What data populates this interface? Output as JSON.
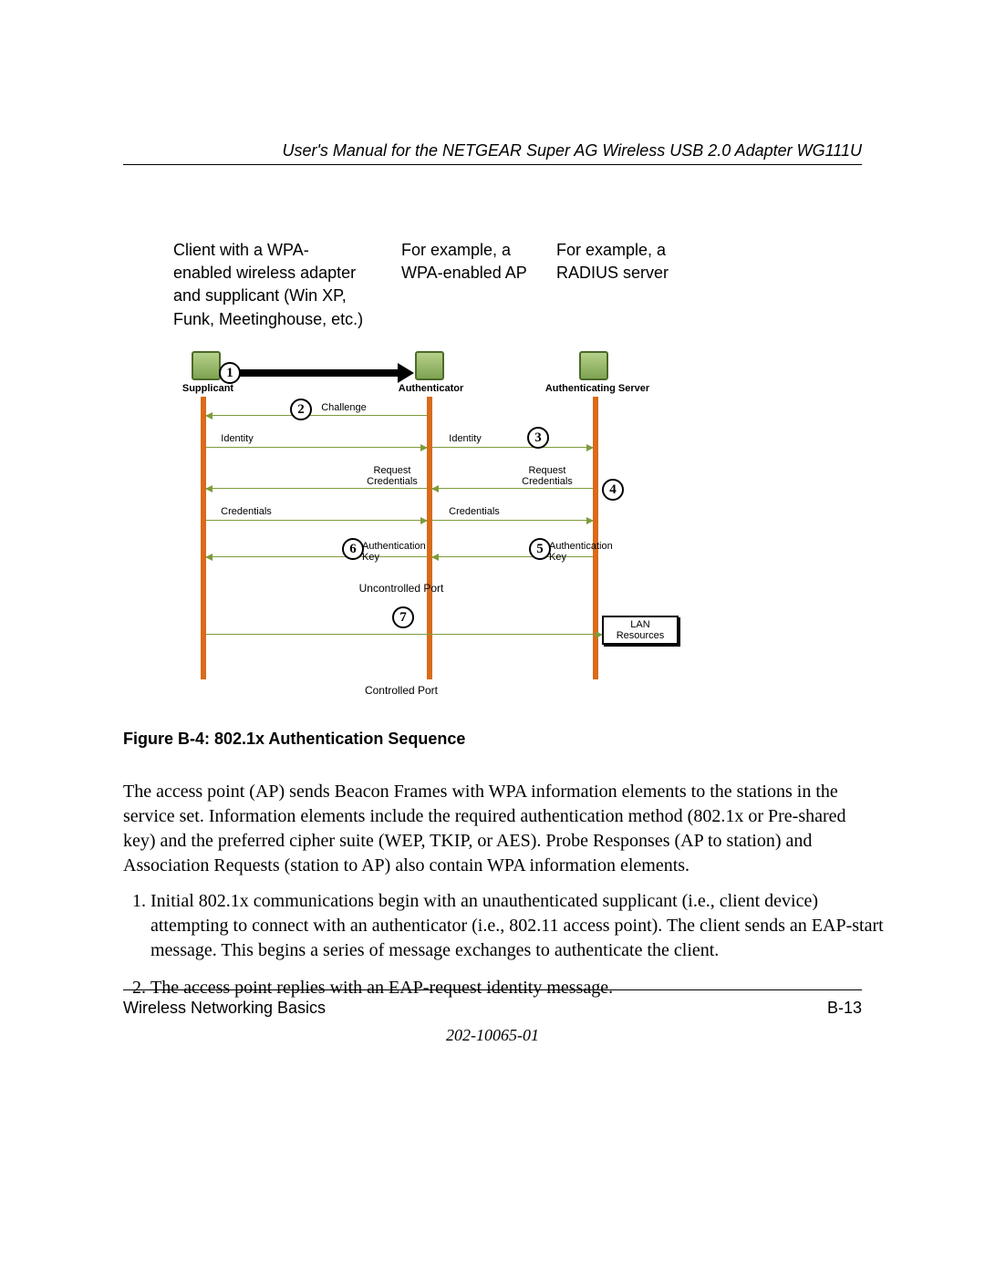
{
  "header": {
    "title": "User's Manual for the NETGEAR Super AG Wireless USB 2.0 Adapter WG111U"
  },
  "figure": {
    "label_supplicant": "Client with a WPA-enabled wireless adapter and supplicant (Win XP, Funk, Meetinghouse, etc.)",
    "label_authenticator": "For example, a WPA-enabled AP",
    "label_server": "For example, a RADIUS server",
    "actor_supplicant": "Supplicant",
    "actor_authenticator": "Authenticator",
    "actor_server": "Authenticating Server",
    "msg_challenge": "Challenge",
    "msg_identity": "Identity",
    "msg_request_credentials": "Request Credentials",
    "msg_credentials": "Credentials",
    "msg_auth_key": "Authentication Key",
    "uncontrolled_port": "Uncontrolled Port",
    "controlled_port": "Controlled Port",
    "lan_resources": "LAN Resources",
    "n1": "1",
    "n2": "2",
    "n3": "3",
    "n4": "4",
    "n5": "5",
    "n6": "6",
    "n7": "7",
    "caption": "Figure B-4:  802.1x Authentication Sequence"
  },
  "body": {
    "para": "The access point (AP) sends Beacon Frames with WPA information elements to the stations in the service set. Information elements include the required authentication method (802.1x or Pre-shared key) and the preferred cipher suite (WEP, TKIP, or AES). Probe Responses (AP to station) and Association Requests (station to AP) also contain WPA information elements.",
    "steps": [
      "Initial 802.1x communications begin with an unauthenticated supplicant (i.e., client device) attempting to connect with an authenticator (i.e., 802.11 access point). The client sends an EAP-start message. This begins a series of message exchanges to authenticate the client.",
      "The access point replies with an EAP-request identity message."
    ]
  },
  "footer": {
    "section": "Wireless Networking Basics",
    "page": "B-13",
    "docnum": "202-10065-01"
  }
}
